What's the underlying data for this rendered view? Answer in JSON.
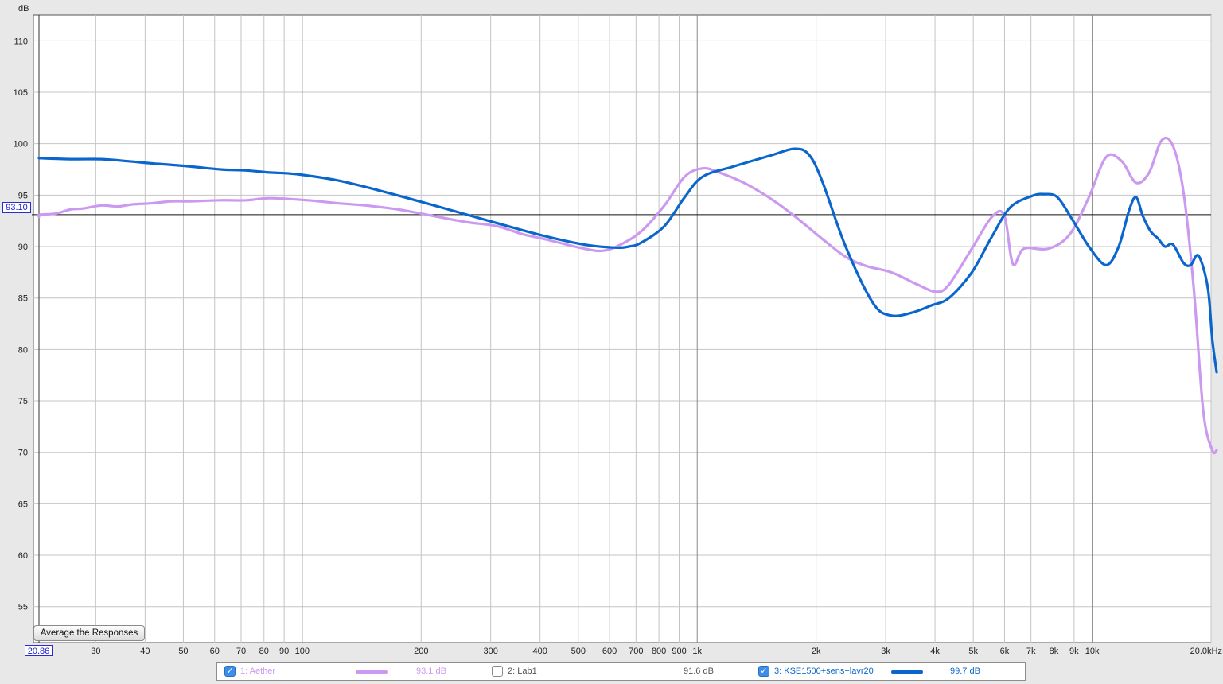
{
  "chart_data": {
    "type": "line",
    "x_scale": "log",
    "xlim": [
      20.86,
      20000
    ],
    "ylim": [
      51.5,
      112.5
    ],
    "y_unit_label": "dB",
    "x_ticks": [
      {
        "v": 30,
        "label": "30"
      },
      {
        "v": 40,
        "label": "40"
      },
      {
        "v": 50,
        "label": "50"
      },
      {
        "v": 60,
        "label": "60"
      },
      {
        "v": 70,
        "label": "70"
      },
      {
        "v": 80,
        "label": "80"
      },
      {
        "v": 90,
        "label": "90"
      },
      {
        "v": 100,
        "label": "100"
      },
      {
        "v": 200,
        "label": "200"
      },
      {
        "v": 300,
        "label": "300"
      },
      {
        "v": 400,
        "label": "400"
      },
      {
        "v": 500,
        "label": "500"
      },
      {
        "v": 600,
        "label": "600"
      },
      {
        "v": 700,
        "label": "700"
      },
      {
        "v": 800,
        "label": "800"
      },
      {
        "v": 900,
        "label": "900"
      },
      {
        "v": 1000,
        "label": "1k"
      },
      {
        "v": 2000,
        "label": "2k"
      },
      {
        "v": 3000,
        "label": "3k"
      },
      {
        "v": 4000,
        "label": "4k"
      },
      {
        "v": 5000,
        "label": "5k"
      },
      {
        "v": 6000,
        "label": "6k"
      },
      {
        "v": 7000,
        "label": "7k"
      },
      {
        "v": 8000,
        "label": "8k"
      },
      {
        "v": 9000,
        "label": "9k"
      },
      {
        "v": 10000,
        "label": "10k"
      },
      {
        "v": 20000,
        "label": "20.0kHz"
      }
    ],
    "y_ticks": [
      55,
      60,
      65,
      70,
      75,
      80,
      85,
      90,
      95,
      100,
      105,
      110
    ],
    "x_start_label": "20.86",
    "cursor_y_label": "93.10",
    "cursor_y": 93.1,
    "grid": true,
    "series": [
      {
        "name": "1: Aether",
        "color": "#cc99f0",
        "value_label": "93.1 dB",
        "checked": true,
        "x": [
          20.86,
          21,
          23,
          25,
          27,
          30,
          33,
          36,
          40,
          45,
          50,
          60,
          70,
          80,
          100,
          120,
          140,
          170,
          200,
          250,
          300,
          350,
          400,
          500,
          560,
          620,
          700,
          800,
          900,
          1000,
          1100,
          1300,
          1600,
          2000,
          2300,
          2600,
          3000,
          3500,
          3900,
          4200,
          4800,
          5400,
          5800,
          6100,
          6500,
          7500,
          8500,
          9500,
          10500,
          11500,
          12500,
          13500,
          14500,
          15500,
          16500,
          17500,
          18500,
          19500,
          20000
        ],
        "y": [
          92.9,
          93.1,
          93.2,
          93.6,
          93.7,
          94.0,
          93.9,
          94.1,
          94.2,
          94.4,
          94.4,
          94.5,
          94.5,
          94.7,
          94.5,
          94.2,
          94.0,
          93.6,
          93.1,
          92.4,
          92.0,
          91.2,
          90.7,
          89.8,
          89.6,
          90.2,
          91.5,
          94.0,
          96.8,
          97.6,
          97.2,
          96.0,
          93.8,
          90.8,
          89.0,
          88.1,
          87.5,
          86.3,
          85.6,
          86.3,
          89.8,
          92.9,
          93.0,
          88.3,
          89.8,
          89.8,
          91.2,
          94.8,
          98.7,
          98.3,
          96.2,
          97.2,
          100.3,
          99.8,
          95.2,
          86.0,
          74.0,
          70.2,
          70.2
        ]
      },
      {
        "name": "2: Lab1",
        "color": "#555555",
        "value_label": "91.6 dB",
        "checked": false
      },
      {
        "name": "3: KSE1500+sens+lavr20",
        "color": "#0a66cc",
        "value_label": "99.7 dB",
        "checked": true,
        "x": [
          20.86,
          25,
          30,
          35,
          40,
          50,
          60,
          70,
          80,
          90,
          100,
          120,
          150,
          200,
          300,
          400,
          500,
          600,
          650,
          700,
          800,
          900,
          1000,
          1200,
          1500,
          1700,
          1850,
          2000,
          2300,
          2700,
          3000,
          3400,
          3800,
          4200,
          4800,
          5400,
          6000,
          6800,
          7300,
          7900,
          8600,
          9500,
          10500,
          11300,
          12000,
          12500,
          13000,
          13600,
          14200,
          14800,
          15500,
          16500,
          17200,
          18000,
          19000,
          19500,
          20000
        ],
        "y": [
          98.6,
          98.5,
          98.5,
          98.3,
          98.1,
          97.8,
          97.5,
          97.4,
          97.2,
          97.1,
          96.9,
          96.4,
          95.5,
          94.2,
          92.3,
          91.0,
          90.2,
          89.9,
          90.0,
          90.4,
          92.0,
          94.8,
          96.8,
          97.8,
          98.9,
          99.5,
          99.0,
          96.5,
          90.0,
          84.5,
          83.3,
          83.6,
          84.3,
          85.0,
          87.5,
          91.0,
          93.8,
          94.9,
          95.1,
          94.8,
          92.7,
          90.0,
          88.2,
          90.0,
          93.5,
          94.8,
          93.0,
          91.5,
          90.8,
          90.0,
          90.2,
          88.4,
          88.2,
          89.1,
          86.0,
          81.0,
          77.8
        ]
      }
    ]
  },
  "controls": {
    "average_button": "Average the Responses"
  }
}
